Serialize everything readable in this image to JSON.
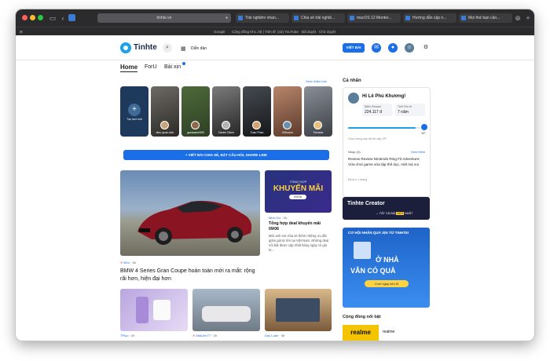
{
  "browser": {
    "url": "tinhte.vn",
    "tabs": [
      "Trải nghiệm nhan...",
      "Chia sẻ trải nghiệ...",
      "macOS 12 Monter...",
      "Hướng dẫn cập n...",
      "Mọi thứ bạn cần..."
    ],
    "bookmarks": [
      "Google",
      "Cộng đồng Khc..hệ | Tinh tế",
      "(42) YouTube",
      "Đã duyệt",
      "Chờ duyệt"
    ]
  },
  "header": {
    "logo": "Tinhte",
    "forum_label": "Diễn đàn",
    "post_button": "VIẾT BÀI"
  },
  "feed_tabs": [
    "Home",
    "ForU",
    "Bài xịn"
  ],
  "stories": {
    "see_more": "Xem nhiều hơn",
    "create_label": "Tạo fact mới",
    "items": [
      {
        "name": "dieu.quan.sinh"
      },
      {
        "name": "gasbasinh990"
      },
      {
        "name": "Daniel Gilmn"
      },
      {
        "name": "Tuan Phan"
      },
      {
        "name": "93huann"
      },
      {
        "name": "Tolvastz"
      }
    ]
  },
  "composer": {
    "label": "+ VIẾT BÀI CHIA SẺ, ĐẶT CÂU HỎI, SHARE LINK"
  },
  "featured": {
    "author": "Đều",
    "time": "3h",
    "title": "BMW 4 Series Gran Coupe hoàn toàn mới ra mắt: rộng rãi hơn, hiện đại hơn"
  },
  "side_card": {
    "promo_top": "TỔNG HỢP",
    "promo_main": "KHUYẾN MÃI",
    "promo_date": "09/06",
    "author": "Minh Dự",
    "time": "2h",
    "title": "Tổng hợp deal khuyến mãi 09/06",
    "excerpt": "Mời anh em chia sẻ thêm những ưu đãi giảm giá từ lớn tại Việt Nam. Những deal nổi bật được cập nhật hàng ngày có giá trị..."
  },
  "bottom_cards": [
    {
      "author": "TPluo",
      "time": "2h"
    },
    {
      "author": "MaiLinh77",
      "time": "2h"
    },
    {
      "author": "Duy Luân",
      "time": "3h"
    }
  ],
  "sidebar": {
    "section_title": "Cá nhân",
    "greeting": "Hi Lê Phú Khương!",
    "points_label": "Điểm Reward",
    "points_value": "224.117 đ",
    "age_label": "Tuổi Tinh tế",
    "age_value": "7 năm",
    "vip_label": "VIP",
    "progress_caption": "Chúc mừng bạn đã lên cấp VIP",
    "progress_fraction": 0.94,
    "drafts_label": "Nháp (3)",
    "drafts_link": "Xem thêm",
    "draft_title": "Review Review Nintendo Ring Fit Adventure: Vừa chơi game vừa tập thể dục, mệt mà vui",
    "draft_meta": "Đã lưu: 1 tháng",
    "creator_brand": "Tinhte Creator",
    "creator_link": "TẤT CẢ BÀI",
    "creator_badge": "MỚI",
    "creator_tail": "NHẤT",
    "promo_title": "CƠ HỘI NHẬN QUÀ XỊN TỪ TINHTE!",
    "promo_line1": "Ở NHÀ",
    "promo_line2": "VẪN CÓ QUÀ",
    "promo_button": "Chơi ngay kẻo lỡ",
    "community_title": "Cộng đồng nổi bật",
    "community_name": "realme",
    "community_logo": "realme"
  },
  "colors": {
    "brand_blue": "#1a6ee8",
    "logo_cyan": "#1aa3e8",
    "promo_blue": "#1e63c8",
    "creator_dark": "#1b1f3b",
    "realme_yellow": "#f4c400"
  }
}
